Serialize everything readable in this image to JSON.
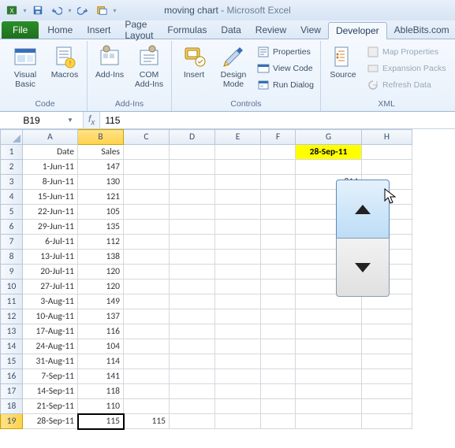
{
  "title": {
    "doc": "moving chart",
    "sep": " - ",
    "app": "Microsoft Excel"
  },
  "tabs": {
    "file": "File",
    "list": [
      "Home",
      "Insert",
      "Page Layout",
      "Formulas",
      "Data",
      "Review",
      "View",
      "Developer",
      "AbleBits.com"
    ],
    "active": 7
  },
  "ribbon": {
    "code": {
      "label": "Code",
      "visual_basic": "Visual\nBasic",
      "macros": "Macros"
    },
    "addins": {
      "label": "Add-Ins",
      "addins": "Add-Ins",
      "com": "COM\nAdd-Ins"
    },
    "controls": {
      "label": "Controls",
      "insert": "Insert",
      "design": "Design\nMode",
      "properties": "Properties",
      "viewcode": "View Code",
      "rundialog": "Run Dialog"
    },
    "xml": {
      "label": "XML",
      "source": "Source",
      "mapprops": "Map Properties",
      "expansion": "Expansion Packs",
      "refresh": "Refresh Data"
    }
  },
  "namebox": "B19",
  "formula": "115",
  "columns": [
    "A",
    "B",
    "C",
    "D",
    "E",
    "F",
    "G",
    "H"
  ],
  "headers": {
    "A": "Date",
    "B": "Sales"
  },
  "rows": [
    {
      "n": 1,
      "A": "Date",
      "B": "Sales",
      "G": "28-Sep-11",
      "G_hl": true,
      "A_hdr": true
    },
    {
      "n": 2,
      "A": "1-Jun-11",
      "B": "147"
    },
    {
      "n": 3,
      "A": "8-Jun-11",
      "B": "130",
      "G": "814"
    },
    {
      "n": 4,
      "A": "15-Jun-11",
      "B": "121"
    },
    {
      "n": 5,
      "A": "22-Jun-11",
      "B": "105"
    },
    {
      "n": 6,
      "A": "29-Jun-11",
      "B": "135"
    },
    {
      "n": 7,
      "A": "6-Jul-11",
      "B": "112"
    },
    {
      "n": 8,
      "A": "13-Jul-11",
      "B": "138"
    },
    {
      "n": 9,
      "A": "20-Jul-11",
      "B": "120"
    },
    {
      "n": 10,
      "A": "27-Jul-11",
      "B": "120"
    },
    {
      "n": 11,
      "A": "3-Aug-11",
      "B": "149"
    },
    {
      "n": 12,
      "A": "10-Aug-11",
      "B": "137"
    },
    {
      "n": 13,
      "A": "17-Aug-11",
      "B": "116"
    },
    {
      "n": 14,
      "A": "24-Aug-11",
      "B": "104"
    },
    {
      "n": 15,
      "A": "31-Aug-11",
      "B": "114"
    },
    {
      "n": 16,
      "A": "7-Sep-11",
      "B": "141"
    },
    {
      "n": 17,
      "A": "14-Sep-11",
      "B": "118"
    },
    {
      "n": 18,
      "A": "21-Sep-11",
      "B": "110"
    },
    {
      "n": 19,
      "A": "28-Sep-11",
      "B": "115",
      "C": "115",
      "active": "B"
    }
  ],
  "active_cell": "B19",
  "spin": {
    "value": 814
  }
}
